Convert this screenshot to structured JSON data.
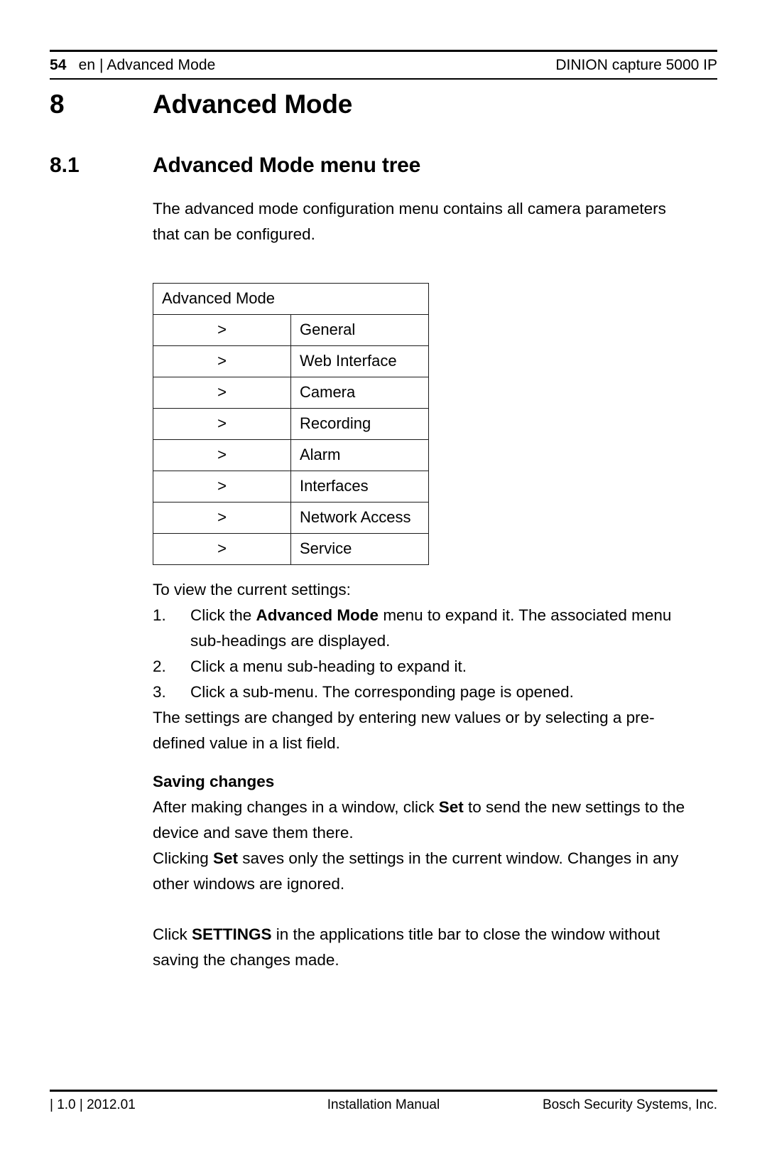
{
  "header": {
    "page_number": "54",
    "location": "en | Advanced Mode",
    "product": "DINION capture 5000 IP"
  },
  "chapter": {
    "number": "8",
    "title": "Advanced Mode"
  },
  "section": {
    "number": "8.1",
    "title": "Advanced Mode menu tree"
  },
  "intro": {
    "paragraph": "The advanced mode configuration menu contains all camera parameters that can be configured."
  },
  "menu_tree": {
    "root_label": "Advanced Mode",
    "arrow": ">",
    "items": [
      "General",
      "Web Interface",
      "Camera",
      "Recording",
      "Alarm",
      "Interfaces",
      "Network Access",
      "Service"
    ]
  },
  "steps": {
    "intro": "To view the current settings:",
    "items": [
      {
        "marker": "1.",
        "before": "Click the ",
        "bold": "Advanced Mode",
        "after": " menu to expand it. The associated menu sub-headings are displayed."
      },
      {
        "marker": "2.",
        "before": "Click a menu sub-heading to expand it.",
        "bold": "",
        "after": ""
      },
      {
        "marker": "3.",
        "before": "Click a sub-menu. The corresponding page is opened.",
        "bold": "",
        "after": ""
      }
    ],
    "after_paragraph": "The settings are changed by entering new values or by selecting a pre-defined value in a list field."
  },
  "saving": {
    "heading": "Saving changes",
    "para1_before": "After making changes in a window, click ",
    "para1_bold": "Set",
    "para1_after": " to send the new settings to the device and save them there.",
    "para2_before": "Clicking ",
    "para2_bold": "Set",
    "para2_after": " saves only the settings in the current window. Changes in any other windows are ignored."
  },
  "closing": {
    "before": "Click ",
    "bold": "SETTINGS",
    "after": " in the applications title bar to close the window without saving the changes made."
  },
  "footer": {
    "left": "| 1.0 | 2012.01",
    "center": "Installation Manual",
    "right": "Bosch Security Systems, Inc."
  }
}
